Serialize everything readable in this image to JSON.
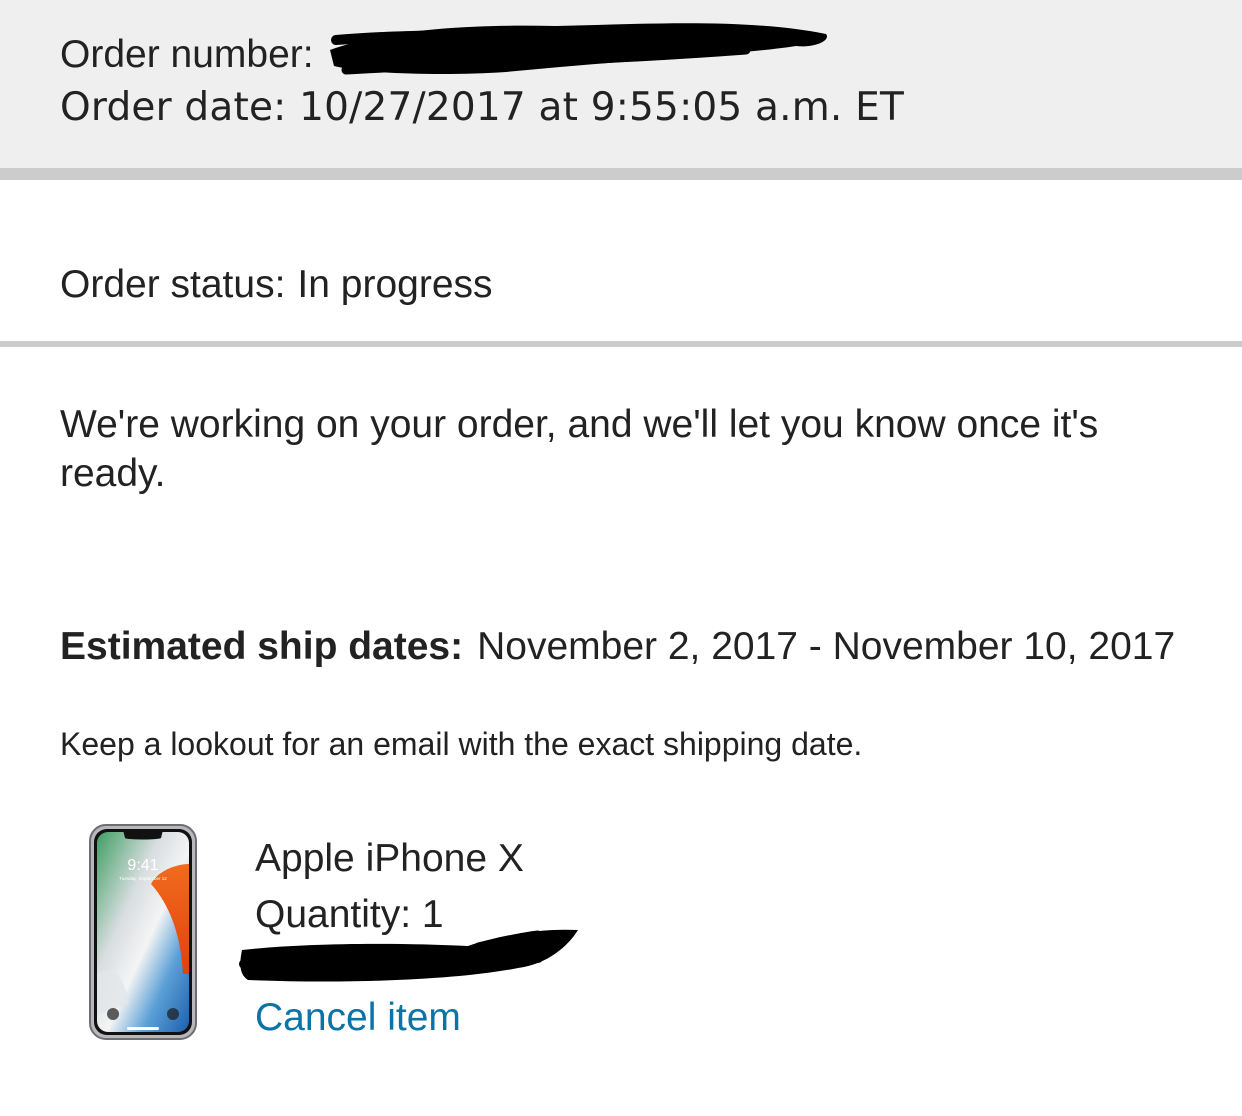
{
  "order": {
    "number_label": "Order number:",
    "date_label": "Order date:",
    "date_value": "10/27/2017 at 9:55:05 a.m. ET"
  },
  "status": {
    "label": "Order status:",
    "value": "In progress"
  },
  "message": "We're working on your order, and we'll let you know once it's ready.",
  "shipping": {
    "label": "Estimated ship dates:",
    "dates": "November 2, 2017 - November 10, 2017",
    "note": "Keep a lookout for an email with the exact shipping date."
  },
  "product": {
    "name": "Apple iPhone X",
    "quantity_label": "Quantity:",
    "quantity": "1",
    "cancel_label": "Cancel item",
    "image_icon": "iphone-x-product-image",
    "screen_time": "9:41",
    "screen_date": "Tuesday, September 12"
  },
  "colors": {
    "header_bg": "#efefef",
    "rule": "#cccccc",
    "text": "#222222",
    "link": "#0a73a8",
    "redaction": "#000000"
  }
}
